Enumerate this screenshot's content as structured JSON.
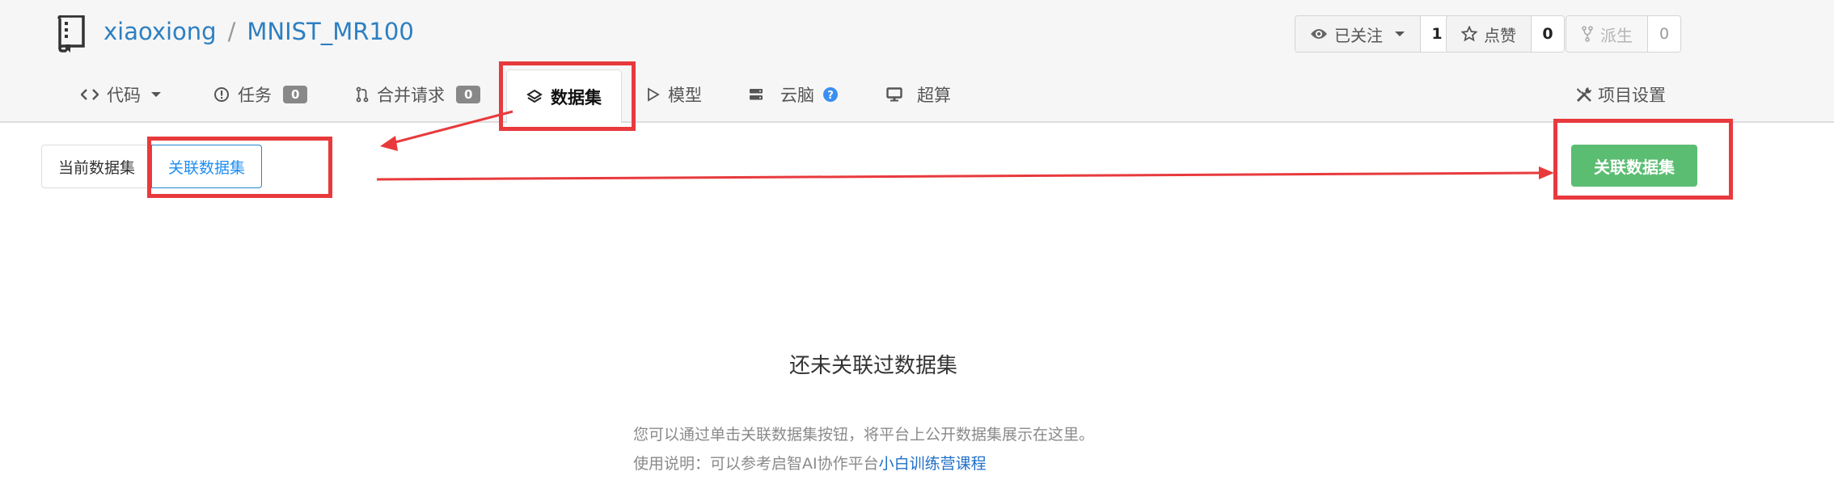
{
  "repo": {
    "owner": "xiaoxiong",
    "separator": "/",
    "name": "MNIST_MR100"
  },
  "actions": {
    "watch": {
      "label": "已关注",
      "count": "1"
    },
    "star": {
      "label": "点赞",
      "count": "0"
    },
    "fork": {
      "label": "派生",
      "count": "0"
    }
  },
  "tabs": [
    {
      "label": "代码"
    },
    {
      "label": "任务",
      "badge": "0"
    },
    {
      "label": "合并请求",
      "badge": "0"
    },
    {
      "label": "数据集"
    },
    {
      "label": "模型"
    },
    {
      "label": "云脑"
    },
    {
      "label": "超算"
    }
  ],
  "settings_label": "项目设置",
  "segmented": {
    "current": "当前数据集",
    "linked": "关联数据集"
  },
  "primary_button": "关联数据集",
  "empty": {
    "title": "还未关联过数据集",
    "line1": "您可以通过单击关联数据集按钮，将平台上公开数据集展示在这里。",
    "line2_prefix": "使用说明：可以参考启智AI协作平台",
    "line2_link": "小白训练营课程"
  },
  "colors": {
    "primary_green": "#5bbd72",
    "link_blue": "#2d7fc1",
    "annotation_red": "#e83a3d",
    "help_blue": "#3b8ff0"
  },
  "icons": [
    "repo-book-icon",
    "eye-icon",
    "star-icon",
    "fork-icon",
    "code-icon",
    "issue-icon",
    "pull-request-icon",
    "layers-icon",
    "play-icon",
    "cloud-server-icon",
    "help-icon",
    "monitor-icon",
    "tools-icon"
  ]
}
